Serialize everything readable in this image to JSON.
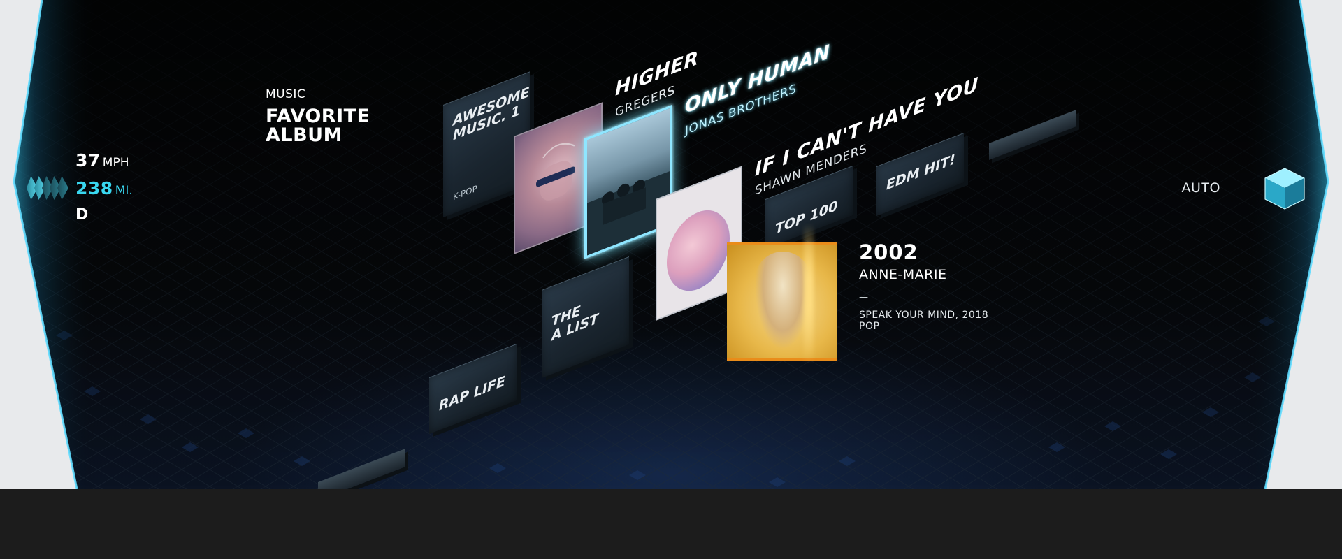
{
  "dash": {
    "speed_value": "37",
    "speed_unit": "MPH",
    "range_value": "238",
    "range_unit": "MI.",
    "gear": "D"
  },
  "section": {
    "label": "MUSIC",
    "title": "FAVORITE\nALBUM"
  },
  "drive_mode": {
    "label": "AUTO",
    "icon": "cube-icon"
  },
  "playlists": [
    {
      "label": "AWESOME\nMUSIC. 1",
      "tag": "K-POP"
    },
    {
      "label": "TOP 100"
    },
    {
      "label": "EDM HIT!"
    },
    {
      "label": "THE\nA LIST"
    },
    {
      "label": "RAP LIFE"
    }
  ],
  "songs": [
    {
      "title": "HIGHER",
      "artist": "GREGERS"
    },
    {
      "title": "ONLY HUMAN",
      "artist": "JONAS BROTHERS"
    },
    {
      "title": "IF I CAN'T HAVE YOU",
      "artist": "SHAWN MENDERS"
    }
  ],
  "selected": {
    "title": "2002",
    "artist": "ANNE-MARIE",
    "dash": "—",
    "album_year": "SPEAK YOUR MIND, 2018",
    "genre": "POP"
  },
  "colors": {
    "accent": "#39d7f0",
    "highlight": "#8fe6ff",
    "selected": "#e8b84a"
  }
}
